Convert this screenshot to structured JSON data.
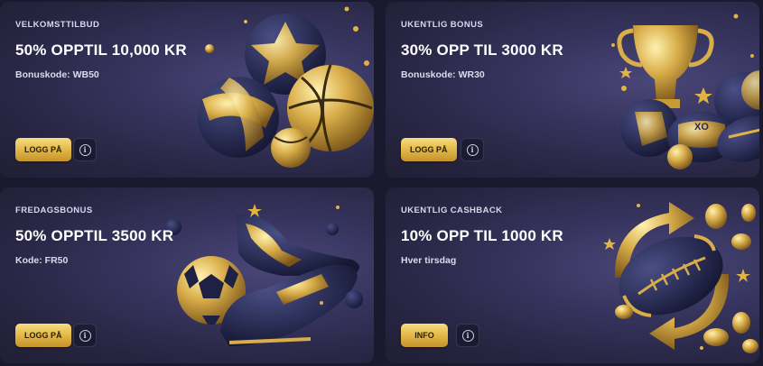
{
  "cards": [
    {
      "tag": "VELKOMSTTILBUD",
      "title": "50% OPPTIL 10,000 KR",
      "code": "Bonuskode: WB50",
      "button": "LOGG PÅ",
      "info_icon": "info-icon",
      "image": "sports-balls"
    },
    {
      "tag": "UKENTLIG BONUS",
      "title": "30% OPP TIL 3000 KR",
      "code": "Bonuskode: WR30",
      "button": "LOGG PÅ",
      "info_icon": "info-icon",
      "image": "trophy-with-balls"
    },
    {
      "tag": "FREDAGSBONUS",
      "title": "50% OPPTIL 3500 KR",
      "code": "Kode: FR50",
      "button": "LOGG PÅ",
      "info_icon": "info-icon",
      "image": "football-boots-and-ball"
    },
    {
      "tag": "UKENTLIG CASHBACK",
      "title": "10% OPP TIL 1000 KR",
      "code": "Hver tirsdag",
      "button": "INFO",
      "info_icon": "info-icon",
      "image": "rugby-ball-with-arrows-and-coins"
    }
  ],
  "colors": {
    "card_bg": "#35335c",
    "gold": "#e0b443",
    "navy": "#262a52"
  }
}
